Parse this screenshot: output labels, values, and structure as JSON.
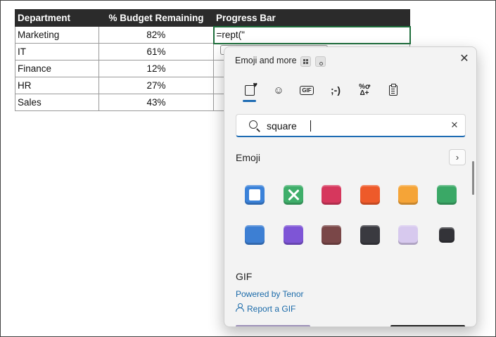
{
  "sheet": {
    "headers": [
      "Department",
      "% Budget Remaining",
      "Progress Bar"
    ],
    "rows": [
      {
        "department": "Marketing",
        "budget": "82%",
        "progress": "=rept(\""
      },
      {
        "department": "IT",
        "budget": "61%",
        "progress": ""
      },
      {
        "department": "Finance",
        "budget": "12%",
        "progress": ""
      },
      {
        "department": "HR",
        "budget": "27%",
        "progress": ""
      },
      {
        "department": "Sales",
        "budget": "43%",
        "progress": ""
      }
    ]
  },
  "panel": {
    "title": "Emoji and more",
    "categories": [
      "emoji-tab",
      "kaomoji-smiley-tab",
      "gif-tab",
      "kaomoji-tab",
      "symbols-tab",
      "clipboard-tab"
    ],
    "gif_glyph": "GIF",
    "kaomoji_glyph": ";-)",
    "symbols_glyph": "%ꝍ\nΔ+",
    "search": {
      "value": "square",
      "placeholder": ""
    },
    "emoji_section": "Emoji",
    "gif_section": "GIF",
    "powered_by": "Powered by Tenor",
    "report": "Report a GIF",
    "emoji_tiles": [
      {
        "name": "white-square-button",
        "color": "#3b82d9"
      },
      {
        "name": "cross-mark-button",
        "color": "#3fae6a"
      },
      {
        "name": "red-square",
        "color": "#d6375d"
      },
      {
        "name": "orange-square",
        "color": "#ee5a2a"
      },
      {
        "name": "yellow-square",
        "color": "#f5a437"
      },
      {
        "name": "green-square",
        "color": "#3aa866"
      },
      {
        "name": "blue-square",
        "color": "#3d7fd3"
      },
      {
        "name": "purple-square",
        "color": "#7e55d6"
      },
      {
        "name": "brown-square",
        "color": "#7a4748"
      },
      {
        "name": "black-square",
        "color": "#3a3a40"
      },
      {
        "name": "white-large-square",
        "color": "#d7c9ee"
      },
      {
        "name": "black-small-square",
        "color": "#333338"
      }
    ]
  },
  "colors": {
    "accent": "#1d6bb3",
    "link": "#1a6aa9",
    "header_bg": "#2b2b2b",
    "edit_border": "#1e6e3c"
  }
}
